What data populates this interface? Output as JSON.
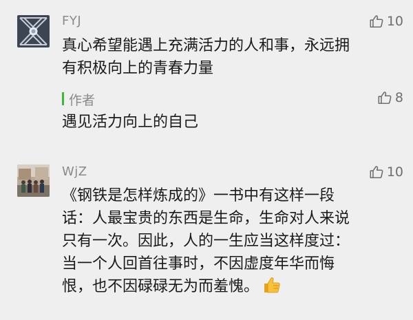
{
  "comments": [
    {
      "nickname": "FYJ",
      "likes": "10",
      "text_lines": [
        "真心希望能遇上充满活力的人和事，永远拥",
        "有积极向上的青春力量"
      ],
      "reply": {
        "label": "作者",
        "likes": "8",
        "text": "遇见活力向上的自己"
      }
    },
    {
      "nickname": "WjZ",
      "likes": "10",
      "text_lines": [
        "《钢铁是怎样炼成的》一书中有这样一段",
        "话：人最宝贵的东西是生命，生命对人来说",
        "只有一次。因此，人的一生应当这样度过：",
        "当一个人回首往事时，不因虚度年华而悔",
        "恨，也不因碌碌无为而羞愧。"
      ],
      "emoji": "thumbs-up-emoji"
    }
  ],
  "icons": {
    "like": "thumb-up-outline-icon"
  },
  "colors": {
    "accent_green": "#3fb73c",
    "meta_gray": "#8a8a8a",
    "text": "#1a1a1a",
    "background": "#efefef"
  }
}
